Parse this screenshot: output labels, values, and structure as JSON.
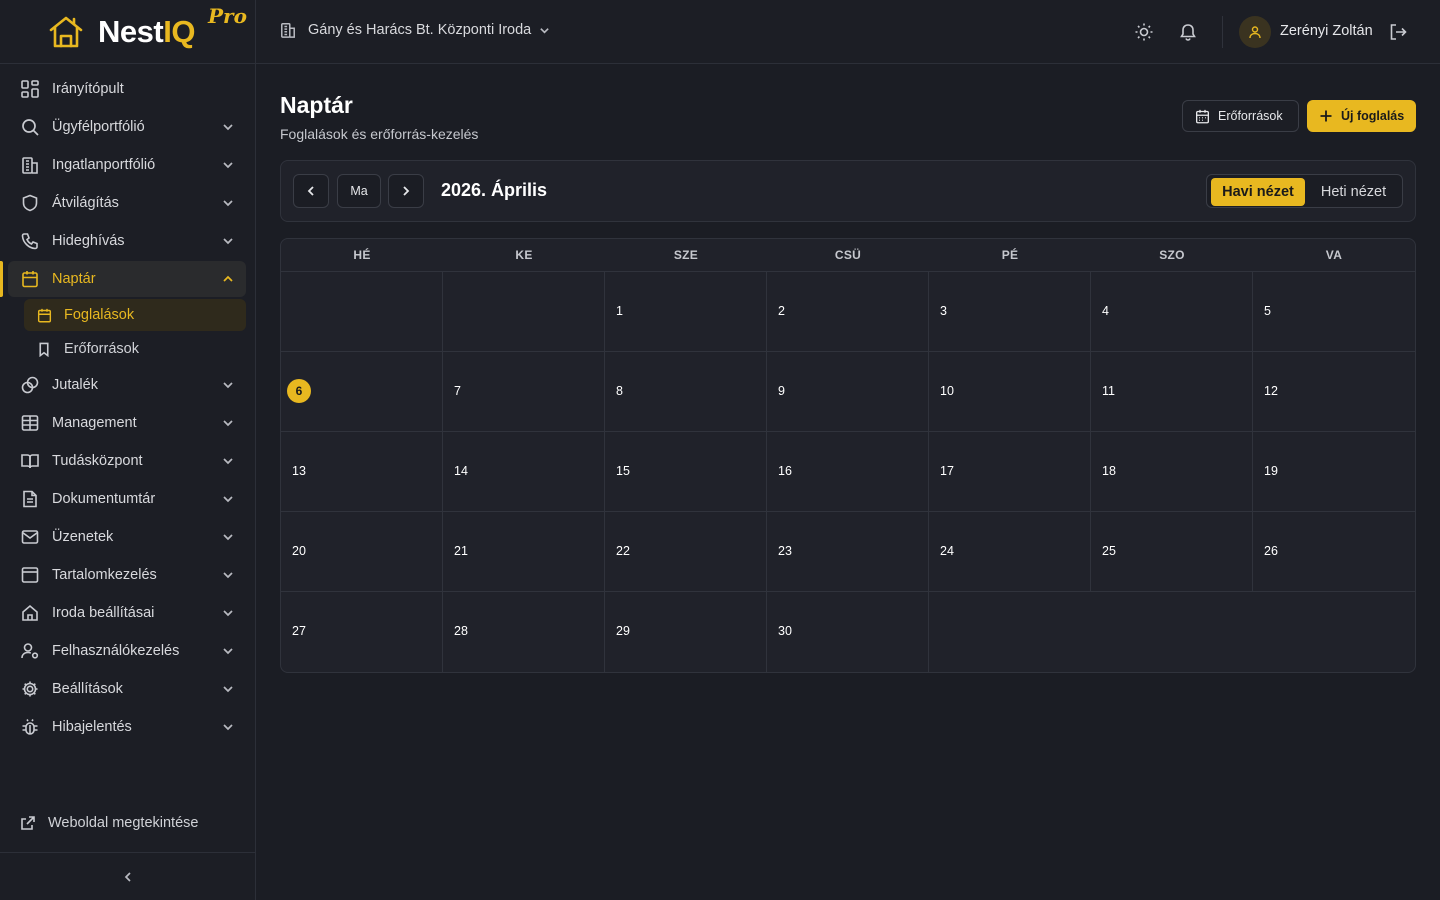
{
  "brand": {
    "name_a": "Nest",
    "name_b": "IQ",
    "tier": "Pro",
    "accent": "#e8b820"
  },
  "sidebar": {
    "items": [
      {
        "label": "Irányítópult",
        "icon": "dashboard-icon"
      },
      {
        "label": "Ügyfélportfólió",
        "icon": "search-icon"
      },
      {
        "label": "Ingatlanportfólió",
        "icon": "building-icon"
      },
      {
        "label": "Átvilágítás",
        "icon": "shield-icon"
      },
      {
        "label": "Hideghívás",
        "icon": "phone-icon"
      },
      {
        "label": "Naptár",
        "icon": "calendar-icon",
        "active": true
      },
      {
        "label": "Jutalék",
        "icon": "coins-icon"
      },
      {
        "label": "Management",
        "icon": "table-icon"
      },
      {
        "label": "Tudásközpont",
        "icon": "book-icon"
      },
      {
        "label": "Dokumentumtár",
        "icon": "document-icon"
      },
      {
        "label": "Üzenetek",
        "icon": "mail-icon"
      },
      {
        "label": "Tartalomkezelés",
        "icon": "layout-icon"
      },
      {
        "label": "Iroda beállításai",
        "icon": "home-icon"
      },
      {
        "label": "Felhasználókezelés",
        "icon": "user-gear-icon"
      },
      {
        "label": "Beállítások",
        "icon": "gear-icon"
      },
      {
        "label": "Hibajelentés",
        "icon": "bug-icon"
      }
    ],
    "sub_items": [
      {
        "label": "Foglalások",
        "icon": "calendar-icon",
        "active": true
      },
      {
        "label": "Erőforrások",
        "icon": "bookmark-icon"
      }
    ],
    "site_link": "Weboldal megtekintése"
  },
  "topbar": {
    "office": "Gány és Harács Bt. Központi Iroda",
    "user_name": "Zerényi Zoltán"
  },
  "page": {
    "title": "Naptár",
    "subtitle": "Foglalások és erőforrás-kezelés",
    "resources_button": "Erőforrások",
    "new_button": "Új foglalás"
  },
  "calendar": {
    "today_button": "Ma",
    "month_label": "2026. Április",
    "view_month": "Havi nézet",
    "view_week": "Heti nézet",
    "weekdays": [
      "HÉ",
      "KE",
      "SZE",
      "CSÜ",
      "PÉ",
      "SZO",
      "VA"
    ],
    "weeks": [
      [
        "",
        "",
        "1",
        "2",
        "3",
        "4",
        "5"
      ],
      [
        "6",
        "7",
        "8",
        "9",
        "10",
        "11",
        "12"
      ],
      [
        "13",
        "14",
        "15",
        "16",
        "17",
        "18",
        "19"
      ],
      [
        "20",
        "21",
        "22",
        "23",
        "24",
        "25",
        "26"
      ],
      [
        "27",
        "28",
        "29",
        "30",
        "",
        "",
        ""
      ]
    ],
    "today": "6"
  }
}
